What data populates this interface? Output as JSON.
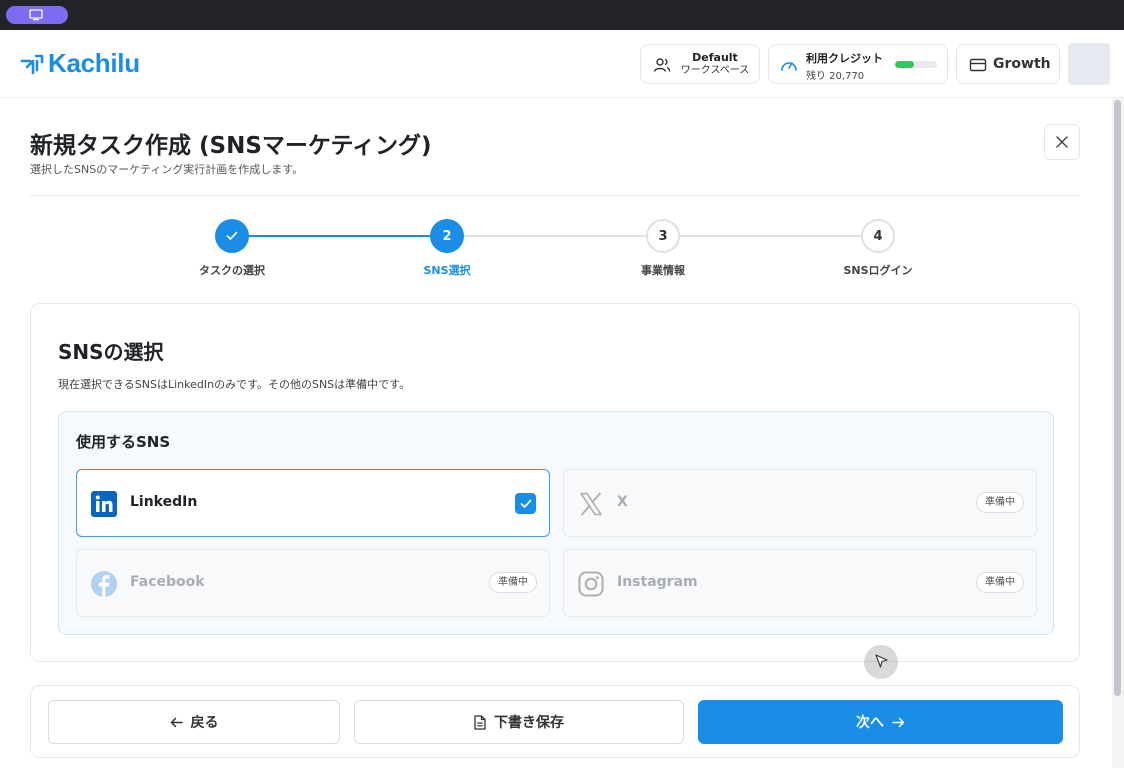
{
  "app": {
    "logo_text": "Kachilu"
  },
  "header": {
    "workspace": {
      "title": "Default",
      "subtitle": "ワークスペース"
    },
    "credit": {
      "title": "利用クレジット",
      "remaining": "残り 20,770",
      "fraction": 0.45
    },
    "plan": {
      "label": "Growth"
    }
  },
  "page": {
    "title": "新規タスク作成 (SNSマーケティング)",
    "subtitle": "選択したSNSのマーケティング実行計画を作成します。"
  },
  "stepper": {
    "steps": [
      {
        "number": "1",
        "label": "タスクの選択",
        "state": "done"
      },
      {
        "number": "2",
        "label": "SNS選択",
        "state": "active"
      },
      {
        "number": "3",
        "label": "事業情報",
        "state": "pending"
      },
      {
        "number": "4",
        "label": "SNSログイン",
        "state": "pending"
      }
    ]
  },
  "sns_section": {
    "title": "SNSの選択",
    "description": "現在選択できるSNSはLinkedInのみです。その他のSNSは準備中です。",
    "group_title": "使用するSNS",
    "options": [
      {
        "name": "LinkedIn",
        "icon": "linkedin-icon",
        "selected": true,
        "badge": ""
      },
      {
        "name": "X",
        "icon": "x-icon",
        "selected": false,
        "badge": "準備中"
      },
      {
        "name": "Facebook",
        "icon": "facebook-icon",
        "selected": false,
        "badge": "準備中"
      },
      {
        "name": "Instagram",
        "icon": "instagram-icon",
        "selected": false,
        "badge": "準備中"
      }
    ]
  },
  "footer": {
    "back_label": "戻る",
    "draft_label": "下書き保存",
    "next_label": "次へ"
  },
  "colors": {
    "accent": "#1a8ee6",
    "credit_bar": "#34c759",
    "topbar": "#222326",
    "pill": "#7c6cf2"
  }
}
